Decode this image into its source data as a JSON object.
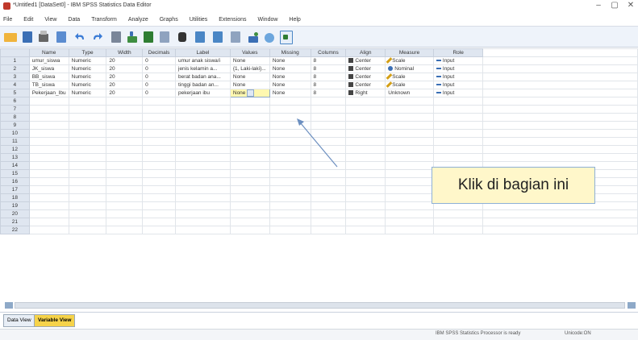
{
  "window": {
    "title": "*Untitled1 [DataSet0] - IBM SPSS Statistics Data Editor",
    "controls": [
      "–",
      "▢",
      "✕"
    ]
  },
  "menubar": [
    "File",
    "Edit",
    "View",
    "Data",
    "Transform",
    "Analyze",
    "Graphs",
    "Utilities",
    "Extensions",
    "Window",
    "Help"
  ],
  "toolbar": {
    "icons": [
      "open-icon",
      "save-icon",
      "print-icon",
      "dialog-recall-icon",
      "undo-icon",
      "redo-icon",
      "goto-case-icon",
      "goto-variable-icon",
      "variables-icon",
      "run-descriptives-icon",
      "find-icon",
      "insert-cases-icon",
      "insert-variable-icon",
      "split-file-icon",
      "weight-cases-icon",
      "select-cases-icon",
      "value-labels-icon"
    ]
  },
  "grid": {
    "headers": [
      "Name",
      "Type",
      "Width",
      "Decimals",
      "Label",
      "Values",
      "Missing",
      "Columns",
      "Align",
      "Measure",
      "Role"
    ],
    "rows": [
      {
        "num": "1",
        "name": "umur_siswa",
        "type": "Numeric",
        "width": "20",
        "decimals": "0",
        "label": "umur anak siswa/i",
        "values": "None",
        "missing": "None",
        "columns": "8",
        "align": "Center",
        "measure": "Scale",
        "role": "Input"
      },
      {
        "num": "2",
        "name": "JK_siswa",
        "type": "Numeric",
        "width": "20",
        "decimals": "0",
        "label": "jenis kelamin a...",
        "values": "{1, Laki-laki}...",
        "missing": "None",
        "columns": "8",
        "align": "Center",
        "measure": "Nominal",
        "role": "Input"
      },
      {
        "num": "3",
        "name": "BB_siswa",
        "type": "Numeric",
        "width": "20",
        "decimals": "0",
        "label": "berat badan ana...",
        "values": "None",
        "missing": "None",
        "columns": "8",
        "align": "Center",
        "measure": "Scale",
        "role": "Input"
      },
      {
        "num": "4",
        "name": "TB_siswa",
        "type": "Numeric",
        "width": "20",
        "decimals": "0",
        "label": "tinggi badan an...",
        "values": "None",
        "missing": "None",
        "columns": "8",
        "align": "Center",
        "measure": "Scale",
        "role": "Input"
      },
      {
        "num": "5",
        "name": "Pekerjaan_Ibu",
        "type": "Numeric",
        "width": "20",
        "decimals": "0",
        "label": "pekerjaan ibu",
        "values": "None",
        "missing": "None",
        "columns": "8",
        "align": "Right",
        "measure": "Unknown",
        "role": "Input"
      }
    ],
    "empty_row_numbers": [
      "6",
      "7",
      "8",
      "9",
      "10",
      "11",
      "12",
      "13",
      "14",
      "15",
      "16",
      "17",
      "18",
      "19",
      "20",
      "21",
      "22"
    ]
  },
  "tabs": {
    "data_view": "Data View",
    "variable_view": "Variable View"
  },
  "status": {
    "processor": "IBM SPSS Statistics Processor is ready",
    "unicode": "Unicode:ON"
  },
  "callout": {
    "text": "Klik di bagian ini"
  },
  "colors": {
    "selected_cell": "#fff8b0",
    "header_bg": "#dfe6f0",
    "callout_bg": "#fff7ca",
    "callout_border": "#8eb0d6",
    "active_tab": "#f6d34a"
  }
}
